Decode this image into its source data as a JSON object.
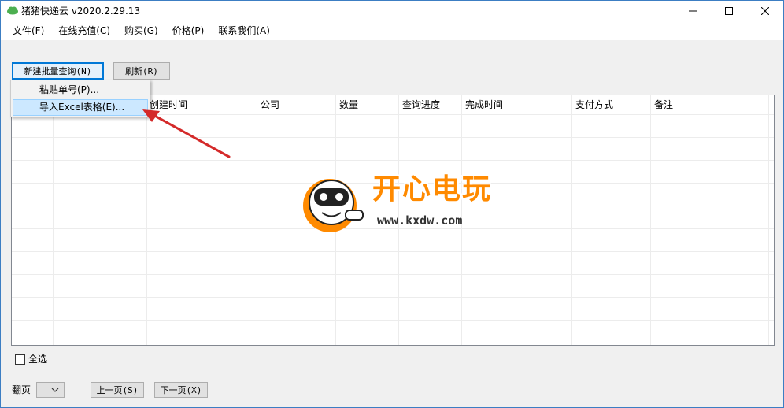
{
  "window": {
    "title": "猪猪快递云 v2020.2.29.13",
    "accent_color": "#3c7ec3"
  },
  "menu": {
    "items": [
      {
        "label": "文件(F)"
      },
      {
        "label": "在线充值(C)"
      },
      {
        "label": "购买(G)"
      },
      {
        "label": "价格(P)"
      },
      {
        "label": "联系我们(A)"
      }
    ]
  },
  "toolbar": {
    "new_batch_label": "新建批量查询(N)",
    "refresh_label": "刷新(R)"
  },
  "dropdown": {
    "paste_label": "粘贴单号(P)...",
    "import_label": "导入Excel表格(E)..."
  },
  "grid": {
    "columns": [
      "",
      "",
      "创建时间",
      "公司",
      "数量",
      "查询进度",
      "完成时间",
      "支付方式",
      "备注"
    ]
  },
  "footer": {
    "select_all_label": "全选",
    "page_label": "翻页",
    "prev_label": "上一页(S)",
    "next_label": "下一页(X)"
  },
  "watermark": {
    "brand": "开心电玩",
    "url": "www.kxdw.com"
  },
  "colors": {
    "highlight": "#cce8ff",
    "arrow": "#d42a2a",
    "brand_orange": "#ff8a00"
  }
}
